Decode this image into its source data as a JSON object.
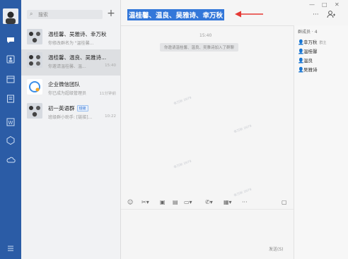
{
  "sidebar": {
    "icons": [
      "chat-icon",
      "contacts-icon",
      "calendar-icon",
      "docs-icon",
      "word-icon",
      "apps-icon",
      "cloud-icon",
      "menu-icon"
    ]
  },
  "search": {
    "placeholder": "搜索"
  },
  "chats": [
    {
      "name": "温桂馨、吴雅诗、幸万秋",
      "preview": "你修改群名为 \"温桂馨...",
      "time": "",
      "badge": ""
    },
    {
      "name": "温桂馨、温良、吴雅诗...",
      "preview": "你邀请温桂馨、温...",
      "time": "15:40",
      "badge": ""
    },
    {
      "name": "企业微信团队",
      "preview": "你已成为超级管理员",
      "time": "11分钟前",
      "badge": ""
    },
    {
      "name": "初一英语群",
      "preview": "班级群小助手: [链接]...",
      "time": "10:22",
      "badge": "班级"
    }
  ],
  "conversation": {
    "title": "温桂馨、温良、吴雅诗、幸万秋",
    "time": "15:40",
    "system_message": "你邀请温桂馨、温良、吴雅诗加入了群聊",
    "send_label": "发送(S)"
  },
  "members": {
    "header": "群成员 · 4",
    "list": [
      {
        "name": "幸万秋",
        "role": "群主"
      },
      {
        "name": "温桂馨",
        "role": ""
      },
      {
        "name": "温良",
        "role": ""
      },
      {
        "name": "吴雅诗",
        "role": ""
      }
    ]
  },
  "colors": {
    "rail": "#2b5ca6",
    "highlight": "#3377d9",
    "arrow": "#e53935"
  }
}
